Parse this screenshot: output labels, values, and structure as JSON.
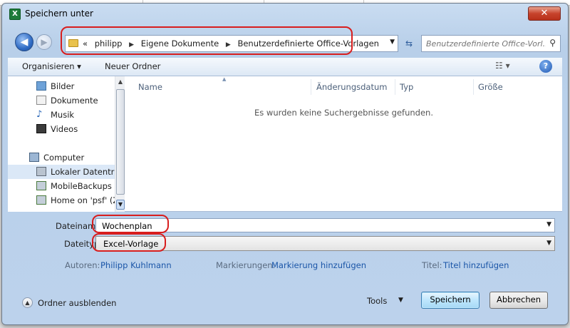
{
  "window": {
    "title": "Speichern unter",
    "close_label": "✕",
    "app_icon": "X"
  },
  "nav": {
    "back_icon": "arrow-left-icon",
    "forward_icon": "arrow-right-icon",
    "breadcrumbs": [
      "«",
      "philipp",
      "Eigene Dokumente",
      "Benutzerdefinierte Office-Vorlagen"
    ],
    "breadcrumb_separator": "▶",
    "search_placeholder": "Benutzerdefinierte Office-Vorl..."
  },
  "toolbar": {
    "organize_label": "Organisieren ▾",
    "new_folder_label": "Neuer Ordner",
    "view_label": "☷ ▾",
    "help_label": "?"
  },
  "sidebar": {
    "items": [
      {
        "label": "Bilder",
        "icon": "pictures-icon"
      },
      {
        "label": "Dokumente",
        "icon": "documents-icon"
      },
      {
        "label": "Musik",
        "icon": "music-icon"
      },
      {
        "label": "Videos",
        "icon": "videos-icon"
      },
      {
        "label": "Computer",
        "icon": "computer-icon"
      },
      {
        "label": "Lokaler Datenträger",
        "icon": "local-disk-icon"
      },
      {
        "label": "MobileBackups c",
        "icon": "network-drive-icon"
      },
      {
        "label": "Home on 'psf' (Z",
        "icon": "network-drive-icon"
      }
    ]
  },
  "file_list": {
    "columns": [
      "Name",
      "Änderungsdatum",
      "Typ",
      "Größe"
    ],
    "empty_message": "Es wurden keine Suchergebnisse gefunden."
  },
  "form": {
    "filename_label": "Dateiname:",
    "filename_value": "Wochenplan",
    "filetype_label": "Dateityp:",
    "filetype_value": "Excel-Vorlage",
    "authors_label": "Autoren:",
    "authors_value": "Philipp Kuhlmann",
    "tags_label": "Markierungen:",
    "tags_value": "Markierung hinzufügen",
    "title_label": "Titel:",
    "title_value": "Titel hinzufügen"
  },
  "footer": {
    "hide_folders_label": "Ordner ausblenden",
    "tools_label": "Tools",
    "save_label": "Speichern",
    "cancel_label": "Abbrechen"
  },
  "colors": {
    "highlight": "#d81e1e",
    "link": "#1b56a8",
    "excel_green": "#1e7b3a"
  }
}
